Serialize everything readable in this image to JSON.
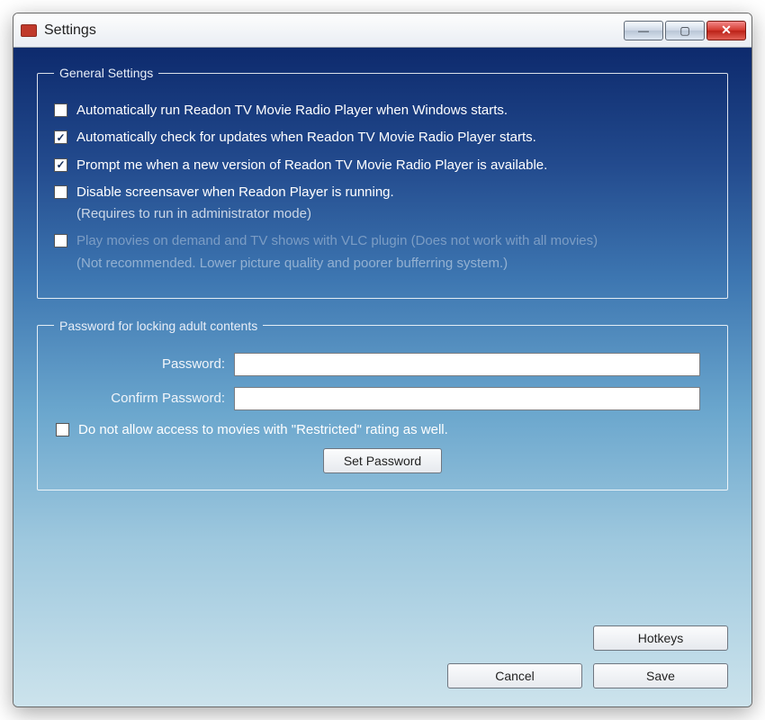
{
  "window": {
    "title": "Settings"
  },
  "general": {
    "legend": "General Settings",
    "items": [
      {
        "label": "Automatically run Readon TV Movie Radio Player when Windows starts.",
        "checked": false,
        "sub": ""
      },
      {
        "label": "Automatically check for updates when Readon TV Movie Radio Player starts.",
        "checked": true,
        "sub": ""
      },
      {
        "label": "Prompt me when a new version of Readon TV Movie Radio Player is available.",
        "checked": true,
        "sub": ""
      },
      {
        "label": "Disable screensaver  when Readon Player is running.",
        "checked": false,
        "sub": "(Requires to run in administrator mode)"
      },
      {
        "label": "Play movies on demand and TV shows with VLC plugin (Does not work with all movies)",
        "checked": false,
        "sub": "(Not recommended. Lower picture quality and poorer bufferring system.)",
        "dim": true
      }
    ]
  },
  "password": {
    "legend": "Password for locking adult contents",
    "password_label": "Password:",
    "confirm_label": "Confirm Password:",
    "restrict_label": "Do not allow access to movies with \"Restricted\" rating as well.",
    "set_btn": "Set Password"
  },
  "buttons": {
    "hotkeys": "Hotkeys",
    "cancel": "Cancel",
    "save": "Save"
  }
}
